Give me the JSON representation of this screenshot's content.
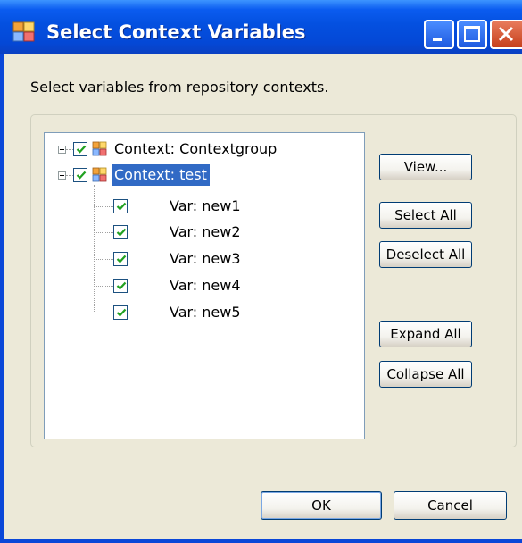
{
  "window": {
    "title": "Select Context Variables"
  },
  "description": "Select variables from repository contexts.",
  "tree": {
    "contexts": [
      {
        "label": "Context: Contextgroup",
        "expanded": false,
        "checked": true,
        "selected": false
      },
      {
        "label": "Context: test",
        "expanded": true,
        "checked": true,
        "selected": true
      }
    ],
    "variables": [
      {
        "label": "Var: new1",
        "checked": true
      },
      {
        "label": "Var: new2",
        "checked": true
      },
      {
        "label": "Var: new3",
        "checked": true
      },
      {
        "label": "Var: new4",
        "checked": true
      },
      {
        "label": "Var: new5",
        "checked": true
      }
    ]
  },
  "buttons": {
    "view": "View...",
    "select_all": "Select All",
    "deselect_all": "Deselect All",
    "expand_all": "Expand All",
    "collapse_all": "Collapse All",
    "ok": "OK",
    "cancel": "Cancel"
  },
  "colors": {
    "selection": "#316ac5",
    "checkmark": "#21a121",
    "window_chrome": "#0450e0",
    "dialog_bg": "#ece9d8"
  },
  "icons": [
    "context-icon",
    "minimize-icon",
    "maximize-icon",
    "close-icon"
  ]
}
